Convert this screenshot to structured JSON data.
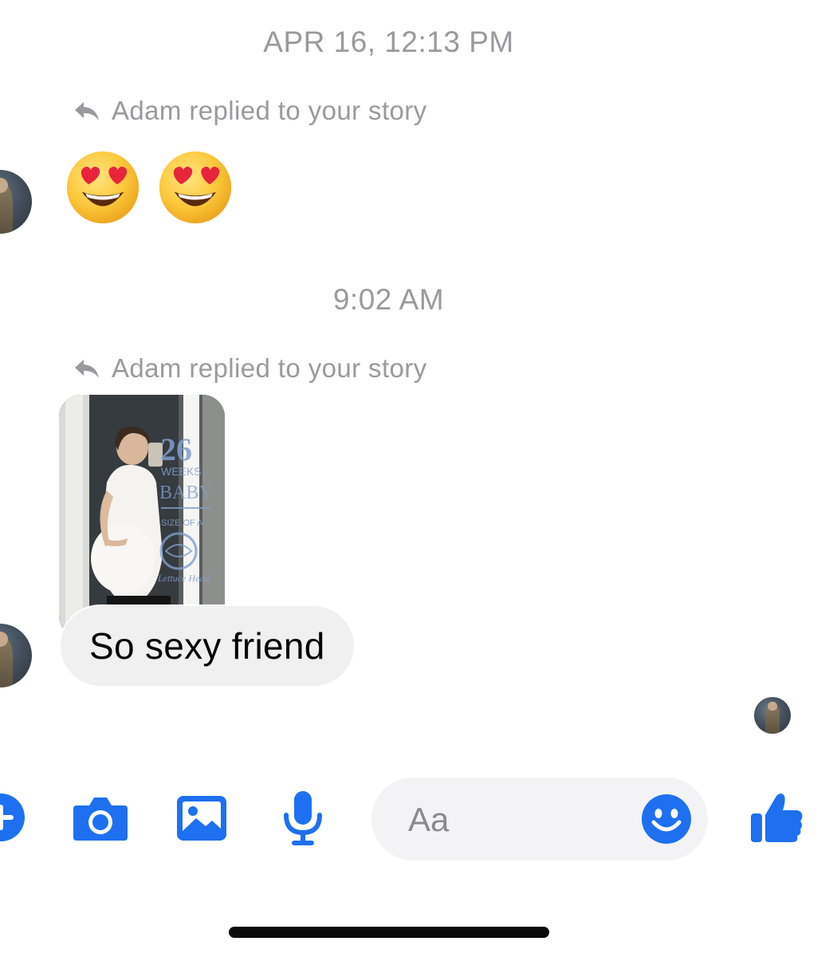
{
  "thread": {
    "timestamp_1": "APR 16, 12:13 PM",
    "timestamp_2": "9:02 AM",
    "reply_note_1": "Adam replied to your story",
    "reply_note_2": "Adam replied to your story",
    "reaction_emojis": [
      "heart-eyes-emoji",
      "heart-eyes-emoji"
    ],
    "story_thumbnail": {
      "overlay_number": "26",
      "overlay_weeks": "WEEKS",
      "overlay_baby": "BABY",
      "overlay_size_line": "SIZE OF A",
      "overlay_item": "Lettuce Head"
    },
    "message_text": "So sexy friend"
  },
  "composer": {
    "placeholder": "Aa",
    "icons": [
      "plus-icon",
      "camera-icon",
      "gallery-icon",
      "microphone-icon",
      "smiley-icon",
      "thumbs-up-icon"
    ]
  },
  "colors": {
    "accent": "#1e70f0",
    "meta_text": "#9a9a9e",
    "bubble_bg": "#f0f0f0",
    "field_bg": "#f3f3f5"
  }
}
